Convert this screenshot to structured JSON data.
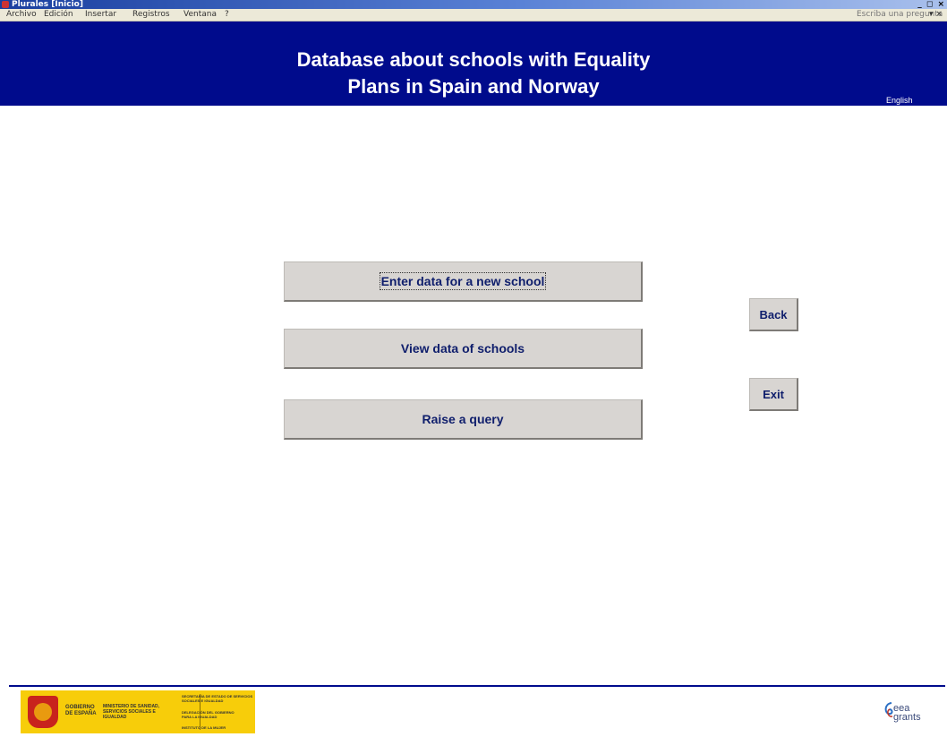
{
  "window": {
    "title": "Plurales  [Inicio]",
    "controls": "_ ◻ ×"
  },
  "menu": {
    "items": [
      "Archivo",
      "Edición",
      "Insertar",
      "Registros",
      "Ventana",
      "?"
    ],
    "help_placeholder": "Escriba una pregunta",
    "help_arrow": "▾ ×"
  },
  "header": {
    "title_line1": "Database about schools with Equality",
    "title_line2": "Plans in Spain and Norway",
    "language": "English",
    "background": "#000b8c"
  },
  "buttons": {
    "enter_data": "Enter data for a new school",
    "view_data": "View data of schools",
    "raise_query": "Raise a query",
    "back": "Back",
    "exit": "Exit"
  },
  "footer": {
    "gov_logo": {
      "gobierno": "GOBIERNO DE ESPAÑA",
      "ministerio": "MINISTERIO DE SANIDAD, SERVICIOS SOCIALES E IGUALDAD",
      "secretaria": "SECRETARÍA DE ESTADO DE SERVICIOS SOCIALES E IGUALDAD",
      "delegacion": "DELEGACIÓN DEL GOBIERNO PARA LA IGUALDAD",
      "instituto": "INSTITUTO DE LA MUJER"
    },
    "eea_logo": "eea grants"
  }
}
